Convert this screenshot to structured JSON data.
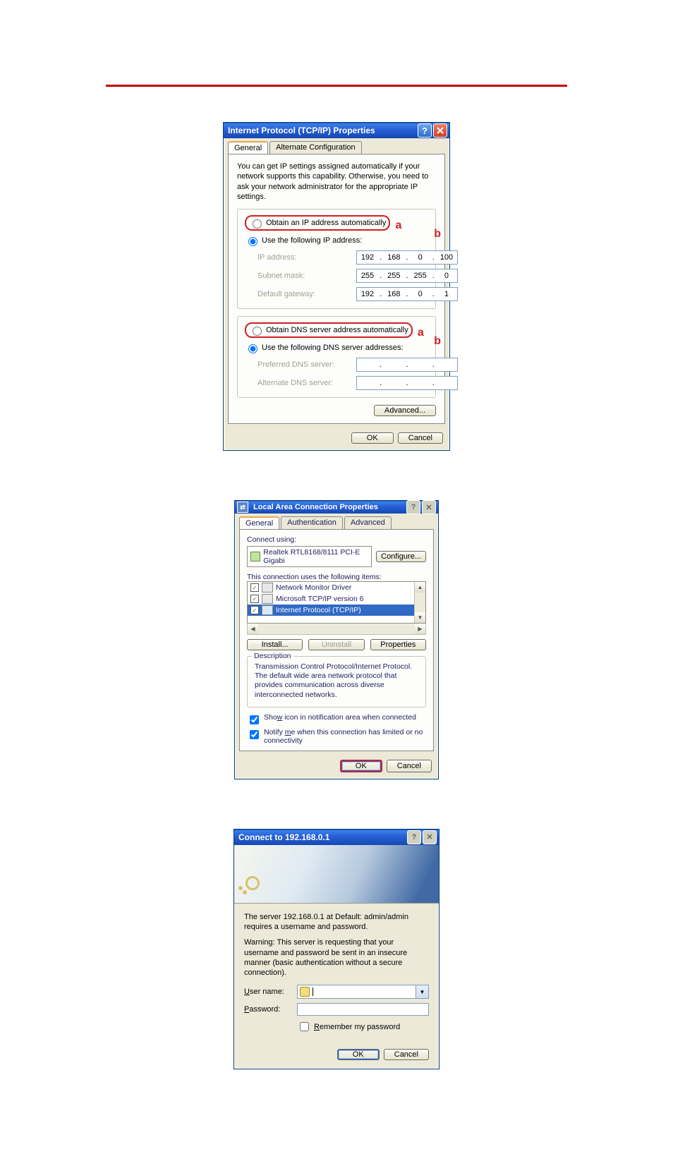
{
  "tcpip": {
    "title": "Internet Protocol (TCP/IP) Properties",
    "tabs": {
      "general": "General",
      "alt": "Alternate Configuration"
    },
    "intro": "You can get IP settings assigned automatically if your network supports this capability. Otherwise, you need to ask your network administrator for the appropriate IP settings.",
    "radio": {
      "obtain_ip": "Obtain an IP address automatically",
      "use_ip": "Use the following IP address:",
      "obtain_dns": "Obtain DNS server address automatically",
      "use_dns": "Use the following DNS server addresses:"
    },
    "labels": {
      "ip": "IP address:",
      "mask": "Subnet mask:",
      "gw": "Default gateway:",
      "pdns": "Preferred DNS server:",
      "adns": "Alternate DNS server:"
    },
    "ip": [
      "192",
      "168",
      "0",
      "100"
    ],
    "mask": [
      "255",
      "255",
      "255",
      "0"
    ],
    "gw": [
      "192",
      "168",
      "0",
      "1"
    ],
    "advanced": "Advanced...",
    "ok": "OK",
    "cancel": "Cancel",
    "ann_a": "a",
    "ann_b": "b"
  },
  "lan": {
    "title": "Local Area Connection Properties",
    "tabs": {
      "general": "General",
      "auth": "Authentication",
      "adv": "Advanced"
    },
    "connect_using": "Connect using:",
    "adapter": "Realtek RTL8168/8111 PCI-E Gigabi",
    "configure": "Configure...",
    "uses_items": "This connection uses the following items:",
    "items": [
      "Network Monitor Driver",
      "Microsoft TCP/IP version 6",
      "Internet Protocol (TCP/IP)"
    ],
    "install": "Install...",
    "uninstall": "Uninstall",
    "properties": "Properties",
    "desc_h": "Description",
    "desc": "Transmission Control Protocol/Internet Protocol. The default wide area network protocol that provides communication across diverse interconnected networks.",
    "show_icon": "Show icon in notification area when connected",
    "notify": "Notify me when this connection has limited or no connectivity",
    "ok": "OK",
    "cancel": "Cancel"
  },
  "auth": {
    "title": "Connect to 192.168.0.1",
    "line1": "The server 192.168.0.1 at Default: admin/admin requires a username and password.",
    "line2": "Warning: This server is requesting that your username and password be sent in an insecure manner (basic authentication without a secure connection).",
    "user_label": "User name:",
    "pass_label": "Password:",
    "remember": "Remember my password",
    "ok": "OK",
    "cancel": "Cancel"
  }
}
